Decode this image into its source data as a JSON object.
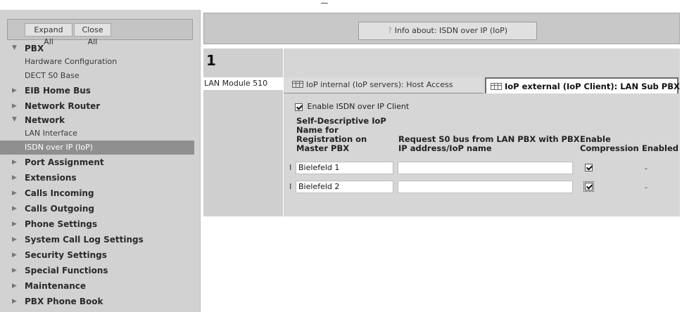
{
  "sidebar": {
    "expand_all": "Expand All",
    "close_all": "Close All",
    "items": [
      {
        "label": "PBX",
        "open": true,
        "children": [
          {
            "label": "Hardware Configuration",
            "selected": false
          },
          {
            "label": "DECT S0 Base",
            "selected": false
          }
        ]
      },
      {
        "label": "EIB Home Bus",
        "open": false
      },
      {
        "label": "Network Router",
        "open": false
      },
      {
        "label": "Network",
        "open": true,
        "children": [
          {
            "label": "LAN Interface",
            "selected": false
          },
          {
            "label": "ISDN over IP (IoP)",
            "selected": true
          }
        ]
      },
      {
        "label": "Port Assignment",
        "open": false
      },
      {
        "label": "Extensions",
        "open": false
      },
      {
        "label": "Calls Incoming",
        "open": false
      },
      {
        "label": "Calls Outgoing",
        "open": false
      },
      {
        "label": "Phone Settings",
        "open": false
      },
      {
        "label": "System Call Log Settings",
        "open": false
      },
      {
        "label": "Security Settings",
        "open": false
      },
      {
        "label": "Special Functions",
        "open": false
      },
      {
        "label": "Maintenance",
        "open": false
      },
      {
        "label": "PBX Phone Book",
        "open": false
      }
    ]
  },
  "info_button": {
    "icon": "?",
    "label": "Info about: ISDN over IP (IoP)"
  },
  "module": {
    "number": "1",
    "name": "LAN Module 510"
  },
  "tabs": [
    {
      "label": "IoP internal (IoP servers): Host Access",
      "active": false
    },
    {
      "label": "IoP external (IoP Client): LAN Sub PBX",
      "active": true
    }
  ],
  "panel": {
    "enable_label": "Enable ISDN over IP Client",
    "enable_checked": true,
    "headers": {
      "name_l1": "Self-Descriptive IoP",
      "name_l2": "Name for",
      "name_l3": "Registration on",
      "name_l4": "Master PBX",
      "request_l1": "Request S0 bus from LAN PBX with PBX",
      "request_l2": "IP address/IoP name",
      "compression_l1": "Enable",
      "compression_l2": "Compression",
      "enabled": "Enabled"
    },
    "rows": [
      {
        "marker": "I",
        "name": "Bielefeld 1",
        "address": "",
        "compression": true,
        "enabled": "-"
      },
      {
        "marker": "I",
        "name": "Bielefeld 2",
        "address": "",
        "compression": true,
        "enabled": "-"
      }
    ]
  }
}
